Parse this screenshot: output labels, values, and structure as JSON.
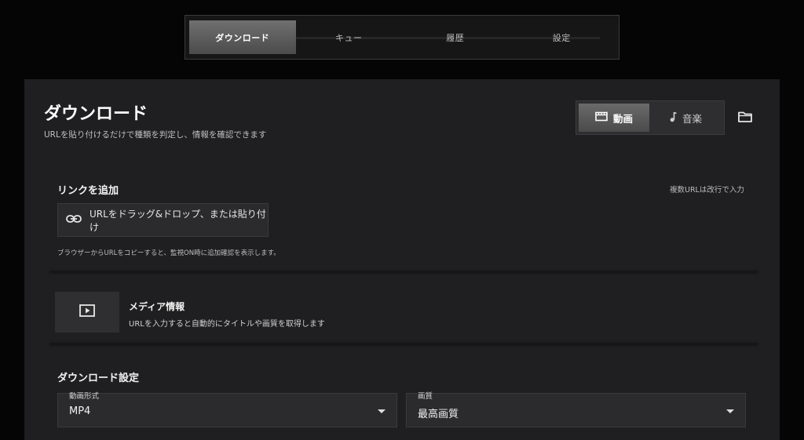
{
  "nav": {
    "tabs": [
      {
        "label": "ダウンロード",
        "active": true
      },
      {
        "label": "キュー",
        "active": false
      },
      {
        "label": "履歴",
        "active": false
      },
      {
        "label": "設定",
        "active": false
      }
    ]
  },
  "header": {
    "title": "ダウンロード",
    "subtitle": "URLを貼り付けるだけで種類を判定し、情報を確認できます"
  },
  "mode": {
    "video_label": "動画",
    "video_icon": "film-icon",
    "music_label": "音楽",
    "music_icon": "music-note-icon",
    "folder_icon": "folder-icon",
    "selected": "video"
  },
  "link": {
    "title": "リンクを追加",
    "multi_hint": "複数URLは改行で入力",
    "drop_label": "URLをドラッグ&ドロップ、または貼り付け",
    "drop_icon": "link-icon",
    "note": "ブラウザーからURLをコピーすると、監視ON時に追加確認を表示します。"
  },
  "media": {
    "icon": "play-icon",
    "title": "メディア情報",
    "subtitle": "URLを入力すると自動的にタイトルや画質を取得します"
  },
  "download_settings": {
    "title": "ダウンロード設定",
    "format_label": "動画形式",
    "format_value": "MP4",
    "quality_label": "画質",
    "quality_value": "最高画質"
  },
  "colors": {
    "background": "#050505",
    "panel": "#1f1f21",
    "control": "#2b2b2d",
    "text": "#e8e8e8"
  }
}
